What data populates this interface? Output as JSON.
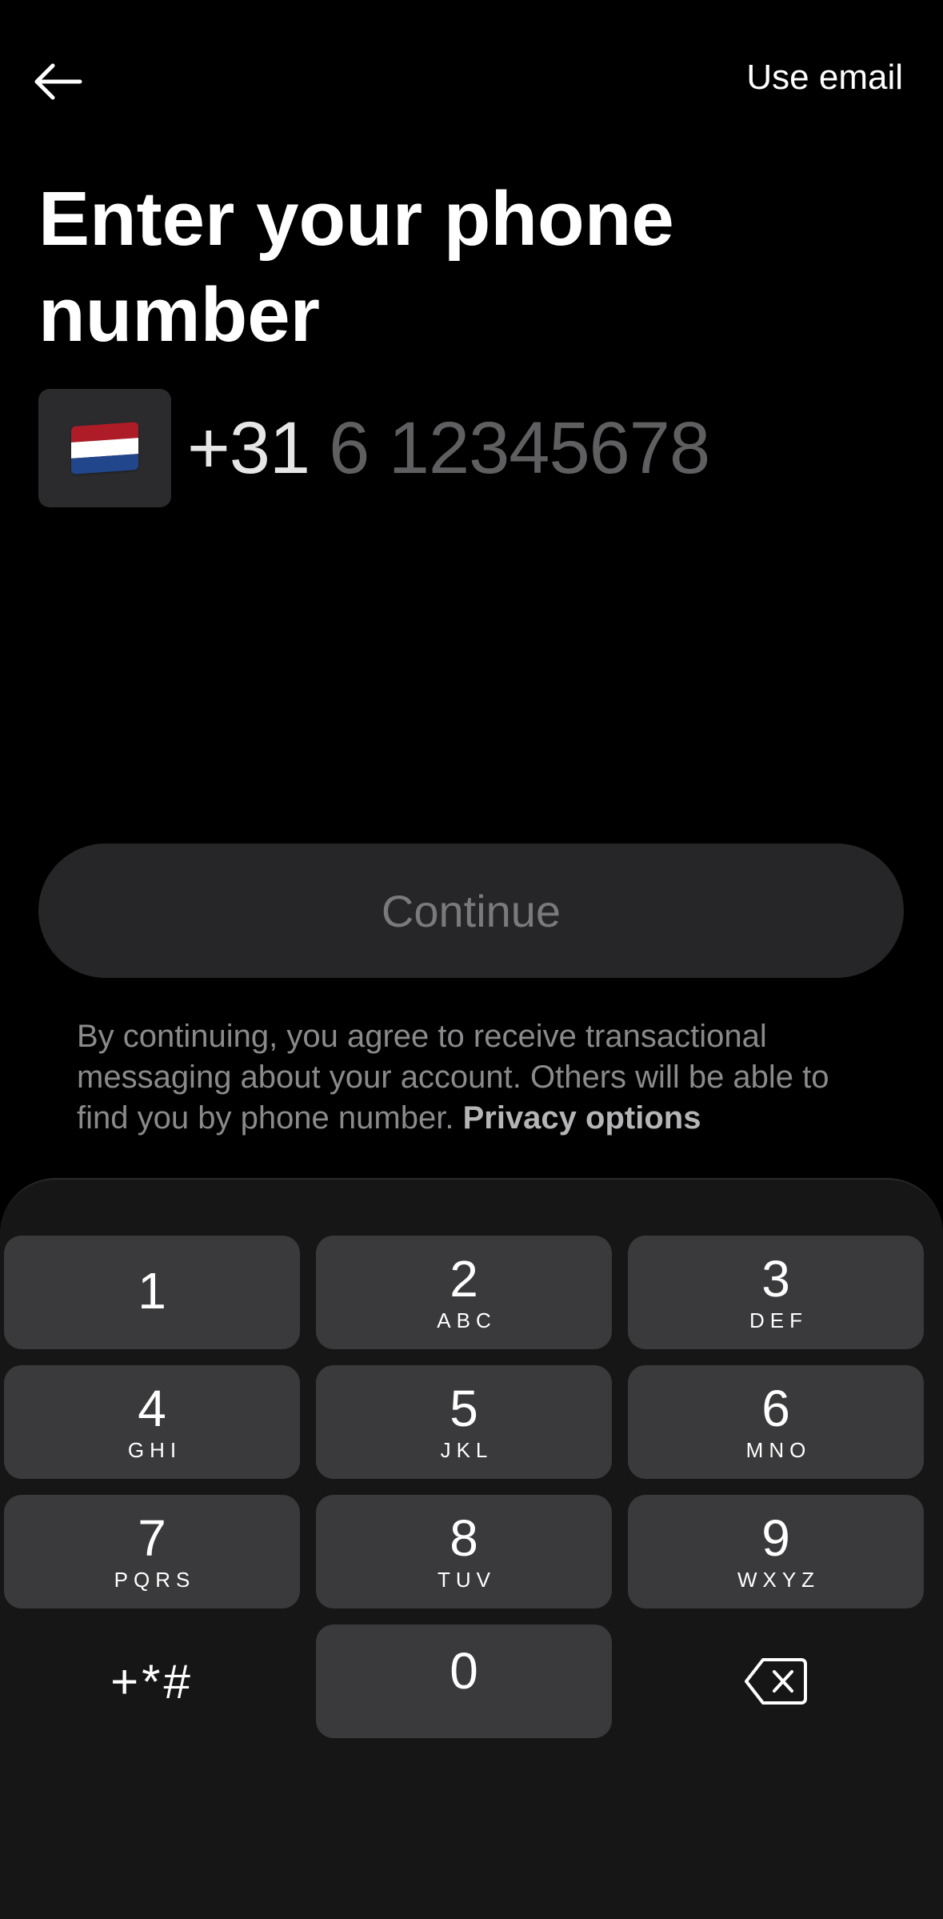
{
  "header": {
    "back_icon": "arrow-left-icon",
    "use_email_label": "Use email"
  },
  "title": "Enter your phone number",
  "phone": {
    "country_flag_icon": "netherlands-flag-icon",
    "flag_colors": [
      "#ae1c28",
      "#ffffff",
      "#21468b"
    ],
    "country_code": "+31",
    "placeholder": "6 12345678",
    "value": ""
  },
  "continue_button": {
    "label": "Continue",
    "enabled": false
  },
  "terms": {
    "text": "By continuing, you agree to receive transactional messaging about your account. Others will be able to find you by phone number.",
    "link_label": "Privacy options"
  },
  "keypad": {
    "keys": [
      {
        "digit": "1",
        "letters": ""
      },
      {
        "digit": "2",
        "letters": "ABC"
      },
      {
        "digit": "3",
        "letters": "DEF"
      },
      {
        "digit": "4",
        "letters": "GHI"
      },
      {
        "digit": "5",
        "letters": "JKL"
      },
      {
        "digit": "6",
        "letters": "MNO"
      },
      {
        "digit": "7",
        "letters": "PQRS"
      },
      {
        "digit": "8",
        "letters": "TUV"
      },
      {
        "digit": "9",
        "letters": "WXYZ"
      },
      {
        "digit": "0",
        "letters": ""
      }
    ],
    "symbols_label": "+*#",
    "backspace_icon": "backspace-icon"
  },
  "colors": {
    "background": "#000000",
    "keypad_background": "#161616",
    "key_background": "#3a3a3c",
    "button_disabled": "#262628"
  }
}
